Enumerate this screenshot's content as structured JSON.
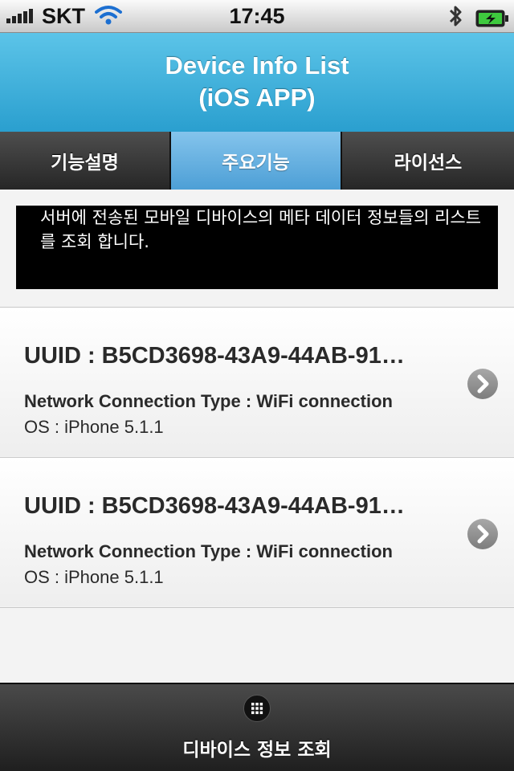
{
  "status_bar": {
    "carrier": "SKT",
    "time": "17:45",
    "icons": [
      "signal-icon",
      "wifi-icon",
      "bluetooth-icon",
      "battery-charging-icon"
    ]
  },
  "header": {
    "title_line1": "Device Info List",
    "title_line2": "(iOS APP)"
  },
  "tabs": [
    {
      "label": "기능설명",
      "active": false
    },
    {
      "label": "주요기능",
      "active": true
    },
    {
      "label": "라이선스",
      "active": false
    }
  ],
  "notice": {
    "text": "서버에 전송된 모바일 디바이스의 메타 데이터 정보들의 리스트를 조회 합니다."
  },
  "devices": [
    {
      "uuid": "UUID : B5CD3698-43A9-44AB-91…",
      "network": "Network Connection Type : WiFi connection",
      "os": "OS : iPhone 5.1.1"
    },
    {
      "uuid": "UUID : B5CD3698-43A9-44AB-91…",
      "network": "Network Connection Type : WiFi connection",
      "os": "OS : iPhone 5.1.1"
    }
  ],
  "bottom_bar": {
    "label": "디바이스 정보 조회",
    "icon": "grid-icon"
  },
  "colors": {
    "header": "#3aaedb",
    "active_tab": "#6cb3e3",
    "tab": "#2f2f2f",
    "notice_bg": "#000000"
  }
}
